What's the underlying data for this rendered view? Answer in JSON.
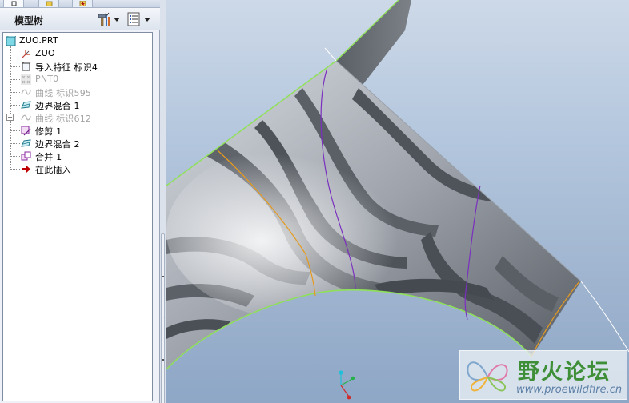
{
  "model_tree": {
    "title": "模型树",
    "items": [
      {
        "label": "ZUO.PRT",
        "icon": "part-icon",
        "state": "normal"
      },
      {
        "label": "ZUO",
        "icon": "coordinate-system-icon",
        "state": "normal"
      },
      {
        "label": "导入特征 标识4",
        "icon": "import-feature-icon",
        "state": "normal"
      },
      {
        "label": "PNT0",
        "icon": "datum-point-icon",
        "state": "disabled"
      },
      {
        "label": "曲线 标识595",
        "icon": "curve-icon",
        "state": "disabled"
      },
      {
        "label": "边界混合 1",
        "icon": "boundary-blend-icon",
        "state": "normal"
      },
      {
        "label": "曲线 标识612",
        "icon": "curve-icon",
        "state": "disabled"
      },
      {
        "label": "修剪 1",
        "icon": "trim-icon",
        "state": "normal"
      },
      {
        "label": "边界混合 2",
        "icon": "boundary-blend-icon",
        "state": "normal"
      },
      {
        "label": "合并 1",
        "icon": "merge-icon",
        "state": "normal"
      },
      {
        "label": "在此插入",
        "icon": "insert-here-arrow-icon",
        "state": "normal"
      }
    ]
  },
  "watermark": {
    "title": "野火论坛",
    "url": "www.proewildfire.cn"
  },
  "colors": {
    "accent_green": "#3f8f39",
    "insert_arrow": "#c00000",
    "surface_edge": "#8fe05a",
    "curve_purple": "#7a2fbf",
    "curve_orange": "#e59a1f"
  }
}
